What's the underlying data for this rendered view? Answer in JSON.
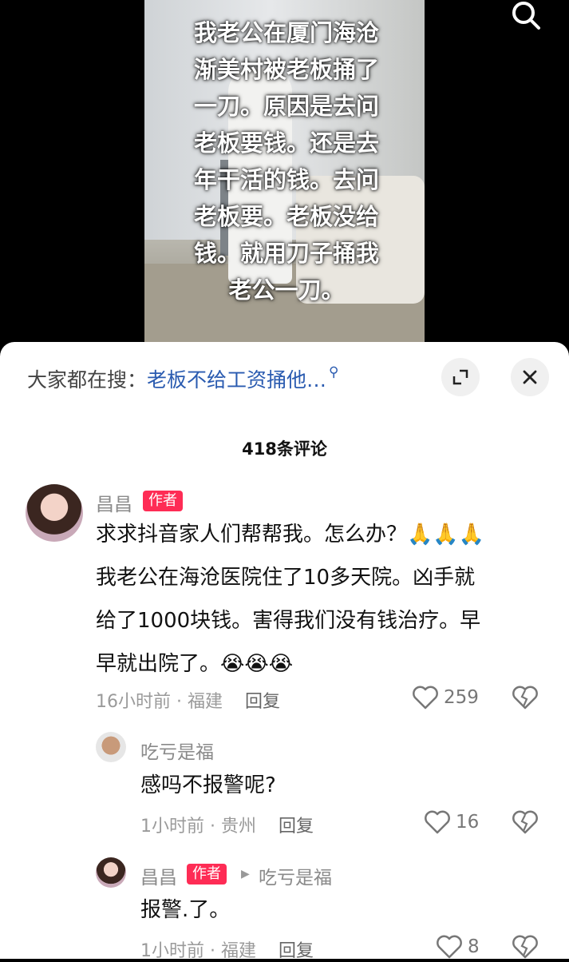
{
  "video": {
    "caption": "我老公在厦门海沧\n渐美村被老板捅了\n一刀。原因是去问\n老板要钱。还是去\n年干活的钱。去问\n老板要。老板没给\n钱。就用刀子捅我\n老公一刀。"
  },
  "sheet": {
    "hot_search_prefix": "大家都在搜：",
    "hot_search_term": "老板不给工资捅他…",
    "comment_count": "418条评论"
  },
  "comments": [
    {
      "user": "昌昌",
      "badge": "作者",
      "text": "求求抖音家人们帮帮我。怎么办？🙏🙏🙏\n我老公在海沧医院住了10多天院。凶手就\n给了1000块钱。害得我们没有钱治疗。早\n早就出院了。😭😭😭",
      "time_location": "16小时前 · 福建",
      "reply_label": "回复",
      "likes": "259"
    },
    {
      "user": "吃亏是福",
      "text": "感吗不报警呢?",
      "time_location": "1小时前 · 贵州",
      "reply_label": "回复",
      "likes": "16"
    },
    {
      "user": "昌昌",
      "badge": "作者",
      "reply_to": "吃亏是福",
      "text": "报警.了。",
      "time_location": "1小时前 · 福建",
      "reply_label": "回复",
      "likes": "8"
    }
  ],
  "colors": {
    "badge": "#fe2c55",
    "link": "#2a5bb0"
  }
}
